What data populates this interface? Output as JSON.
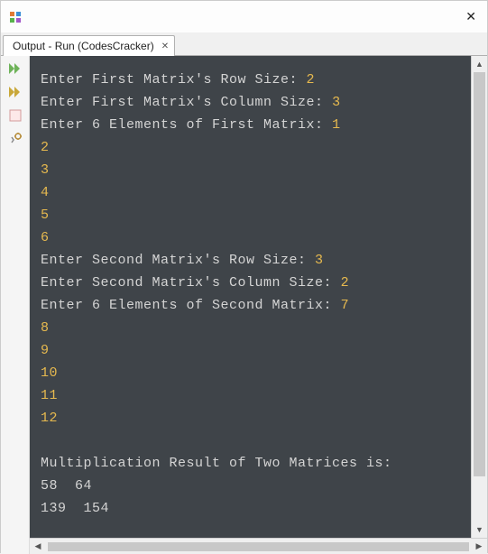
{
  "tab_label": "Output - Run (CodesCracker)",
  "icons": {
    "close_window": "✕",
    "tab_close": "✕",
    "run_play": "▶",
    "scroll_up": "▲",
    "scroll_down": "▼",
    "scroll_left": "◀",
    "scroll_right": "▶"
  },
  "colors": {
    "console_bg": "#3f4449",
    "console_text": "#d4d4d4",
    "input_text": "#e6b94f"
  },
  "console": {
    "p1": "Enter First Matrix's Row Size: ",
    "v1": "2",
    "p2": "Enter First Matrix's Column Size: ",
    "v2": "3",
    "p3": "Enter 6 Elements of First Matrix: ",
    "v3": "1",
    "v4": "2",
    "v5": "3",
    "v6": "4",
    "v7": "5",
    "v8": "6",
    "p9": "Enter Second Matrix's Row Size: ",
    "v9": "3",
    "p10": "Enter Second Matrix's Column Size: ",
    "v10": "2",
    "p11": "Enter 6 Elements of Second Matrix: ",
    "v11": "7",
    "v12": "8",
    "v13": "9",
    "v14": "10",
    "v15": "11",
    "v16": "12",
    "p17": "Multiplication Result of Two Matrices is:",
    "r1": "58  64",
    "r2": "139  154"
  }
}
